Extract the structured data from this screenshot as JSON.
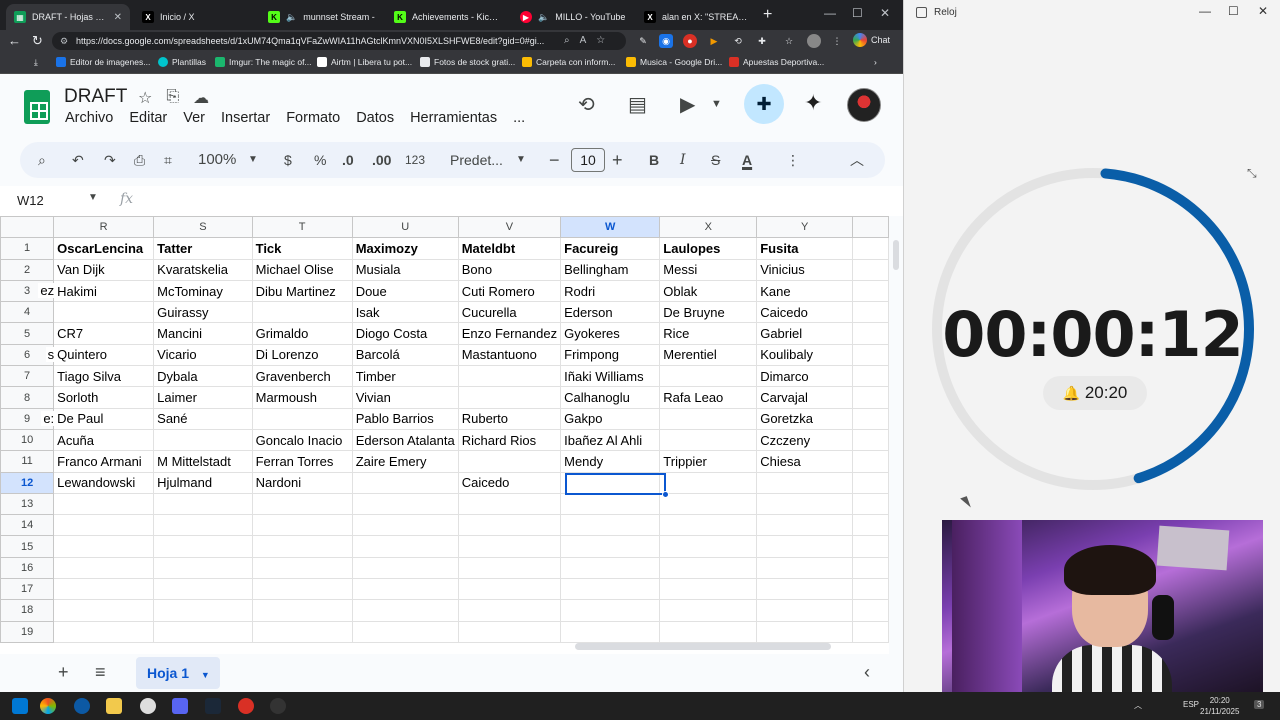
{
  "browser": {
    "tabs": [
      {
        "title": "DRAFT - Hojas de cálcu",
        "favicon": "sheets-icon",
        "active": true
      },
      {
        "title": "Inicio / X",
        "favicon": "x-icon",
        "active": false
      },
      {
        "title": "munnset Stream -",
        "favicon": "kick-icon",
        "active": false
      },
      {
        "title": "Achievements - Kick Da",
        "favicon": "kick-icon",
        "active": false
      },
      {
        "title": "MILLO - YouTube",
        "favicon": "youtube-icon",
        "active": false
      },
      {
        "title": "alan en X: \"STREAMER",
        "favicon": "x-icon",
        "active": false
      }
    ],
    "new_tab": "+",
    "url": "https://docs.google.com/spreadsheets/d/1xUM74Qma1qVFaZwWIA11hAGtclKmnVXN0I5XLSHFWE8/edit?gid=0#gi...",
    "chat_label": "Chat",
    "bookmarks": [
      "Editor de imagenes...",
      "Plantillas",
      "Imgur: The magic of...",
      "Airtm | Libera tu pot...",
      "Fotos de stock grati...",
      "Carpeta con inform...",
      "Musica - Google Dri...",
      "Apuestas Deportiva..."
    ]
  },
  "sheets": {
    "title": "DRAFT",
    "menu": [
      "Archivo",
      "Editar",
      "Ver",
      "Insertar",
      "Formato",
      "Datos",
      "Herramientas",
      "..."
    ],
    "toolbar": {
      "zoom": "100%",
      "currency": "$",
      "percent": "%",
      "dec_decrease": ".0",
      "dec_increase": ".00",
      "number_format": "123",
      "font": "Predet...",
      "font_size": "10",
      "bold": "B",
      "italic": "I",
      "strike": "S",
      "text_color": "A"
    },
    "name_box": "W12",
    "fx_label": "fx",
    "columns": [
      "R",
      "S",
      "T",
      "U",
      "V",
      "W",
      "X",
      "Y"
    ],
    "selected_column": "W",
    "selected_row": 12,
    "partial_cells": [
      "",
      "",
      "ez",
      "",
      "",
      "s",
      "",
      "",
      "e:",
      "",
      "",
      ""
    ],
    "rows": [
      [
        "OscarLencina",
        "Tatter",
        "Tick",
        "Maximozy",
        "Mateldbt",
        "Facureig",
        "Laulopes",
        "Fusita"
      ],
      [
        "Van Dijk",
        "Kvaratskelia",
        "Michael Olise",
        "Musiala",
        "Bono",
        "Bellingham",
        "Messi",
        "Vinicius"
      ],
      [
        "Hakimi",
        "McTominay",
        "Dibu Martinez",
        "Doue",
        "Cuti Romero",
        "Rodri",
        "Oblak",
        "Kane"
      ],
      [
        "",
        "Guirassy",
        "",
        "Isak",
        "Cucurella",
        "Ederson",
        "De Bruyne",
        "Caicedo"
      ],
      [
        "CR7",
        "Mancini",
        "Grimaldo",
        "Diogo Costa",
        "Enzo Fernandez",
        "Gyokeres",
        "Rice",
        "Gabriel"
      ],
      [
        "Quintero",
        "Vicario",
        "Di Lorenzo",
        "Barcolá",
        "Mastantuono",
        "Frimpong",
        "Merentiel",
        "Koulibaly"
      ],
      [
        "Tiago Silva",
        "Dybala",
        "Gravenberch",
        "Timber",
        "",
        "Iñaki Williams",
        "",
        "Dimarco"
      ],
      [
        "Sorloth",
        "Laimer",
        "Marmoush",
        "Vivian",
        "",
        "Calhanoglu",
        "Rafa Leao",
        "Carvajal"
      ],
      [
        "De Paul",
        "Sané",
        "",
        "Pablo Barrios",
        "Ruberto",
        "Gakpo",
        "",
        "Goretzka"
      ],
      [
        "Acuña",
        "",
        "Goncalo Inacio",
        "Ederson Atalanta",
        "Richard Rios",
        "Ibañez Al Ahli",
        "",
        "Czczeny"
      ],
      [
        "Franco Armani",
        "M Mittelstadt",
        "Ferran Torres",
        "Zaire Emery",
        "",
        "Mendy",
        "Trippier",
        "Chiesa"
      ],
      [
        "Lewandowski",
        "Hjulmand",
        "Nardoni",
        "",
        "Caicedo",
        "",
        "",
        ""
      ],
      [
        "",
        "",
        "",
        "",
        "",
        "",
        "",
        ""
      ],
      [
        "",
        "",
        "",
        "",
        "",
        "",
        "",
        ""
      ],
      [
        "",
        "",
        "",
        "",
        "",
        "",
        "",
        ""
      ],
      [
        "",
        "",
        "",
        "",
        "",
        "",
        "",
        ""
      ],
      [
        "",
        "",
        "",
        "",
        "",
        "",
        "",
        ""
      ],
      [
        "",
        "",
        "",
        "",
        "",
        "",
        "",
        ""
      ],
      [
        "",
        "",
        "",
        "",
        "",
        "",
        "",
        ""
      ]
    ],
    "sheet_tab": "Hoja 1"
  },
  "clock": {
    "app_title": "Reloj",
    "timer": "00:00:12",
    "alarm_time": "20:20",
    "progress_fraction": 0.44,
    "accent_color": "#0a5ea8"
  },
  "taskbar": {
    "lang": "ESP",
    "time": "20:20",
    "date": "21/11/2025",
    "notifications": "3"
  }
}
